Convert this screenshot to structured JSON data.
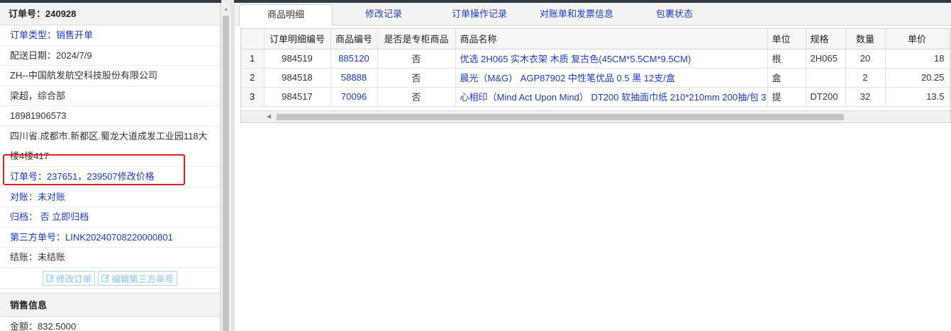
{
  "order": {
    "title": "订单号：240928",
    "type": "订单类型：销售开单",
    "delivery_date": "配送日期：2024/7/9",
    "company": "ZH--中国航发航空科技股份有限公司",
    "contact": "梁超，综合部",
    "phone": "18981906573",
    "address": "四川省.成都市.新都区.蜀龙大道成发工业园118大楼4楼417",
    "related_orders": "订单号：237651，239507修改价格",
    "reconciliation": "对账：未对账",
    "archive": "归档： 否 立即归档",
    "third_party_no": "第三方单号：LINK20240708220000801",
    "settlement": "结账：未结账"
  },
  "buttons": {
    "edit_order": "修改订单",
    "edit_third_party": "编辑第三方单号"
  },
  "sales": {
    "header": "销售信息",
    "amount": "金额：832.5000"
  },
  "tabs": [
    {
      "label": "商品明细",
      "active": true
    },
    {
      "label": "修改记录",
      "active": false
    },
    {
      "label": "订单操作记录",
      "active": false
    },
    {
      "label": "对账单和发票信息",
      "active": false
    },
    {
      "label": "包裹状态",
      "active": false
    }
  ],
  "table": {
    "columns": [
      "",
      "订单明细编号",
      "商品编号",
      "是否是专柜商品",
      "商品名称",
      "单位",
      "规格",
      "数量",
      "单价"
    ],
    "rows": [
      {
        "num": "1",
        "detail_id": "984519",
        "product_code": "885120",
        "counter": "否",
        "name": "优选 2H065 实木衣架 木质 复古色(45CM*5.5CM*9.5CM)",
        "unit": "根",
        "spec": "2H065",
        "qty": "20",
        "price": "18"
      },
      {
        "num": "2",
        "detail_id": "984518",
        "product_code": "58888",
        "counter": "否",
        "name": "晨光（M&G） AGP87902 中性笔优品 0.5 黑 12支/盒",
        "unit": "盒",
        "spec": "",
        "qty": "2",
        "price": "20.25"
      },
      {
        "num": "3",
        "detail_id": "984517",
        "product_code": "70096",
        "counter": "否",
        "name": "心相印（Mind Act Upon Mind） DT200 软抽面巾纸 210*210mm 200抽/包 3",
        "unit": "提",
        "spec": "DT200",
        "qty": "32",
        "price": "13.5"
      }
    ]
  }
}
